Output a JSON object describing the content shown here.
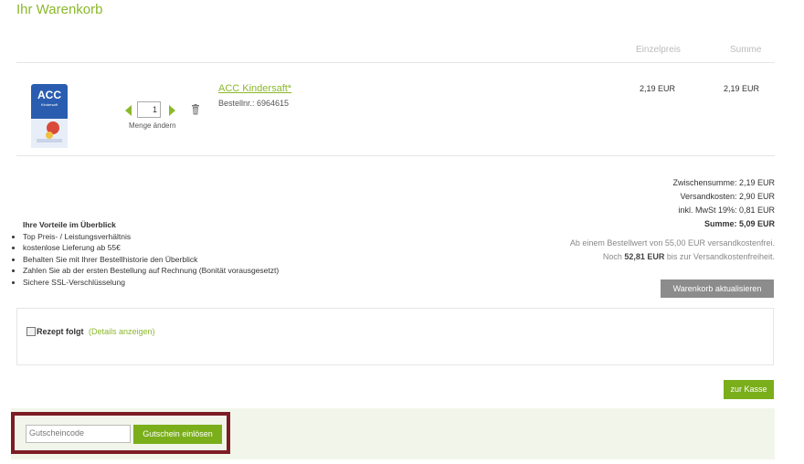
{
  "page": {
    "title": "Ihr Warenkorb"
  },
  "table": {
    "columns": {
      "unit_price": "Einzelpreis",
      "total": "Summe"
    }
  },
  "item": {
    "name": "ACC Kindersaft*",
    "order_no": "Bestellnr.: 6964615",
    "quantity": "1",
    "quantity_label": "Menge ändern",
    "unit_price": "2,19 EUR",
    "total": "2,19 EUR",
    "image_brand": "ACC",
    "image_sub": "Kindersaft"
  },
  "totals": {
    "subtotal": "Zwischensumme: 2,19 EUR",
    "shipping": "Versandkosten: 2,90 EUR",
    "vat": "inkl. MwSt 19%: 0,81 EUR",
    "sum": "Summe: 5,09 EUR",
    "free_shipping_note": "Ab einem Bestellwert von 55,00 EUR versandkostenfrei.",
    "remaining_prefix": "Noch",
    "remaining_amount": "52,81 EUR",
    "remaining_suffix": "bis zur Versandkostenfreiheit."
  },
  "advantages": {
    "title": "Ihre Vorteile im Überblick",
    "items": [
      "Top Preis- / Leistungsverhältnis",
      "kostenlose Lieferung ab 55€",
      "Behalten Sie mit Ihrer Bestellhistorie den Überblick",
      "Zahlen Sie ab der ersten Bestellung auf Rechnung (Bonität vorausgesetzt)",
      "Sichere SSL-Verschlüsselung"
    ]
  },
  "buttons": {
    "update_cart": "Warenkorb aktualisieren",
    "checkout": "zur Kasse",
    "redeem_coupon": "Gutschein einlösen"
  },
  "prescription": {
    "label": "Rezept folgt",
    "details_link": "(Details anzeigen)"
  },
  "coupon": {
    "placeholder": "Gutscheincode"
  },
  "colors": {
    "accent_green": "#8cb82b",
    "button_green": "#7aae1a",
    "button_gray": "#8c8c8c",
    "highlight_frame": "#7c1d25"
  }
}
